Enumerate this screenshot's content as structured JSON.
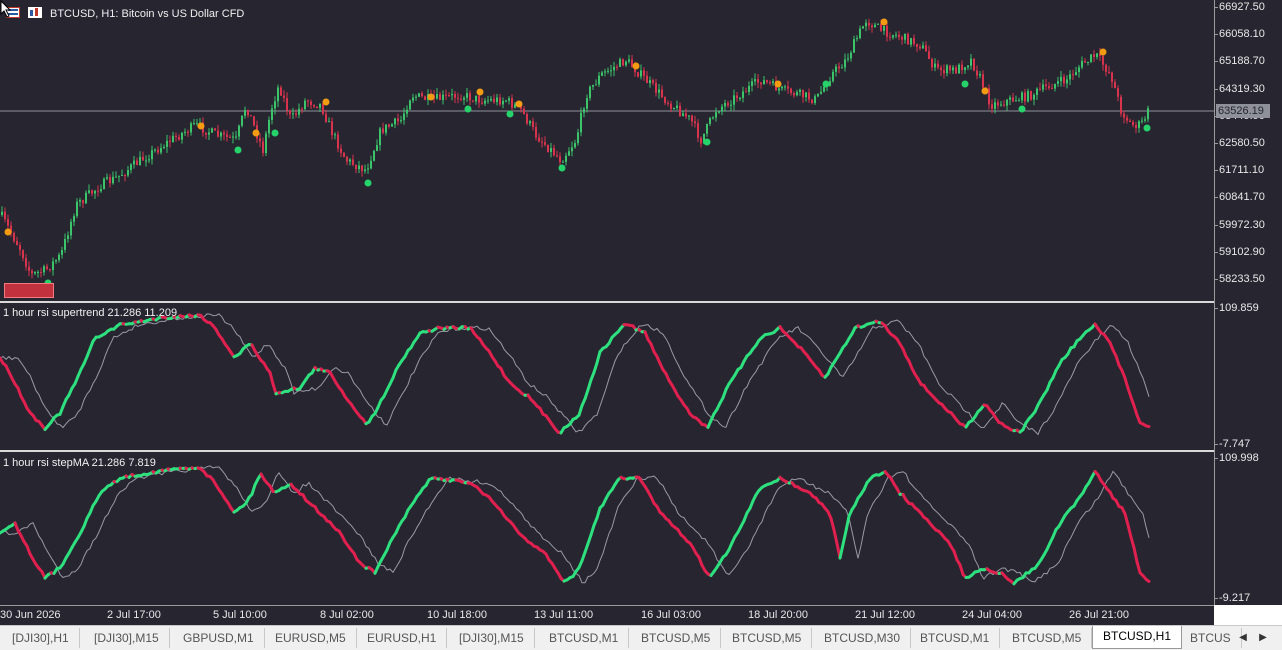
{
  "chart": {
    "title": "BTCUSD, H1:  Bitcoin vs US Dollar CFD",
    "current_price": "63526.19",
    "colors": {
      "background": "#262530",
      "bull": "#2ee07e",
      "bear": "#e0204e",
      "candle_up": "#3bc46a",
      "candle_down": "#d9344e",
      "thin_line": "#9a9aa6",
      "arrow_up": "#25d36a",
      "arrow_down": "#f39c12"
    },
    "price_axis": [
      "66927.50",
      "66058.10",
      "65188.70",
      "64319.30",
      "63449.90",
      "62580.50",
      "61711.10",
      "60841.70",
      "59972.30",
      "59102.90",
      "58233.50"
    ],
    "time_axis": [
      "30 Jun 2026",
      "2 Jul 17:00",
      "5 Jul 10:00",
      "8 Jul 02:00",
      "10 Jul 18:00",
      "13 Jul 11:00",
      "16 Jul 03:00",
      "18 Jul 20:00",
      "21 Jul 12:00",
      "24 Jul 04:00",
      "26 Jul 21:00"
    ]
  },
  "indicator1": {
    "title": "1 hour rsi supertrend  21.286 11.209",
    "axis_top": "109.859",
    "axis_bottom": "-7.747"
  },
  "indicator2": {
    "title": "1 hour rsi stepMA  21.286 7.819",
    "axis_top": "109.998",
    "axis_bottom": "-9.217"
  },
  "tabs": [
    {
      "label": "[DJI30],H1",
      "active": false
    },
    {
      "label": "[DJI30],M15",
      "active": false
    },
    {
      "label": "GBPUSD,M1",
      "active": false
    },
    {
      "label": "EURUSD,M5",
      "active": false
    },
    {
      "label": "EURUSD,H1",
      "active": false
    },
    {
      "label": "[DJI30],M15",
      "active": false
    },
    {
      "label": "BTCUSD,M1",
      "active": false
    },
    {
      "label": "BTCUSD,M5",
      "active": false
    },
    {
      "label": "BTCUSD,M5",
      "active": false
    },
    {
      "label": "BTCUSD,M30",
      "active": false
    },
    {
      "label": "BTCUSD,M1",
      "active": false
    },
    {
      "label": "BTCUSD,M5",
      "active": false
    },
    {
      "label": "BTCUSD,H1",
      "active": true
    },
    {
      "label": "BTCUS",
      "active": false
    }
  ],
  "icons": {
    "chart_menu": "grid-flag-icon",
    "one_click": "trade-icon",
    "cursor": "arrow-cursor-icon",
    "nav_prev": "triangle-left-icon",
    "nav_next": "triangle-right-icon"
  }
}
